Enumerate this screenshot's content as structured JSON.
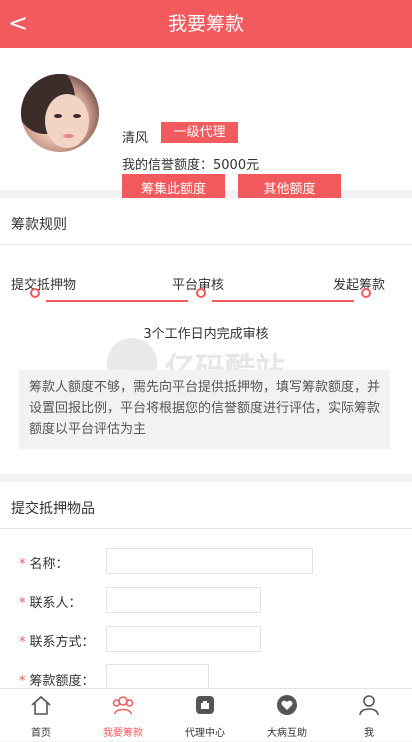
{
  "header": {
    "back": "<",
    "title": "我要筹款"
  },
  "profile": {
    "name": "清风",
    "level": "一级代理",
    "credit": "我的信誉额度：5000元",
    "raise_button": "筹集此额度",
    "other_button": "其他额度"
  },
  "rules": {
    "title": "筹款规则",
    "steps": [
      "提交抵押物",
      "平台审核",
      "发起筹款"
    ],
    "days_note": "3个工作日内完成审核",
    "note": "筹款人额度不够，需先向平台提供抵押物，填写筹款额度，并设置回报比例，平台将根据您的信誉额度进行评估，实际筹款额度以平台评估为主"
  },
  "watermark": "亿码酷站",
  "form": {
    "title": "提交抵押物品",
    "required_mark": "*",
    "fields": [
      {
        "label": "名称：",
        "value": ""
      },
      {
        "label": "联系人：",
        "value": ""
      },
      {
        "label": "联系方式：",
        "value": ""
      },
      {
        "label": "筹款额度：",
        "value": ""
      }
    ]
  },
  "tabbar": [
    {
      "label": "首页",
      "icon": "home-icon",
      "active": false
    },
    {
      "label": "我要筹款",
      "icon": "people-icon",
      "active": true
    },
    {
      "label": "代理中心",
      "icon": "agent-icon",
      "active": false
    },
    {
      "label": "大病互助",
      "icon": "heart-icon",
      "active": false
    },
    {
      "label": "我",
      "icon": "user-icon",
      "active": false
    }
  ],
  "colors": {
    "accent": "#f25a5e"
  }
}
